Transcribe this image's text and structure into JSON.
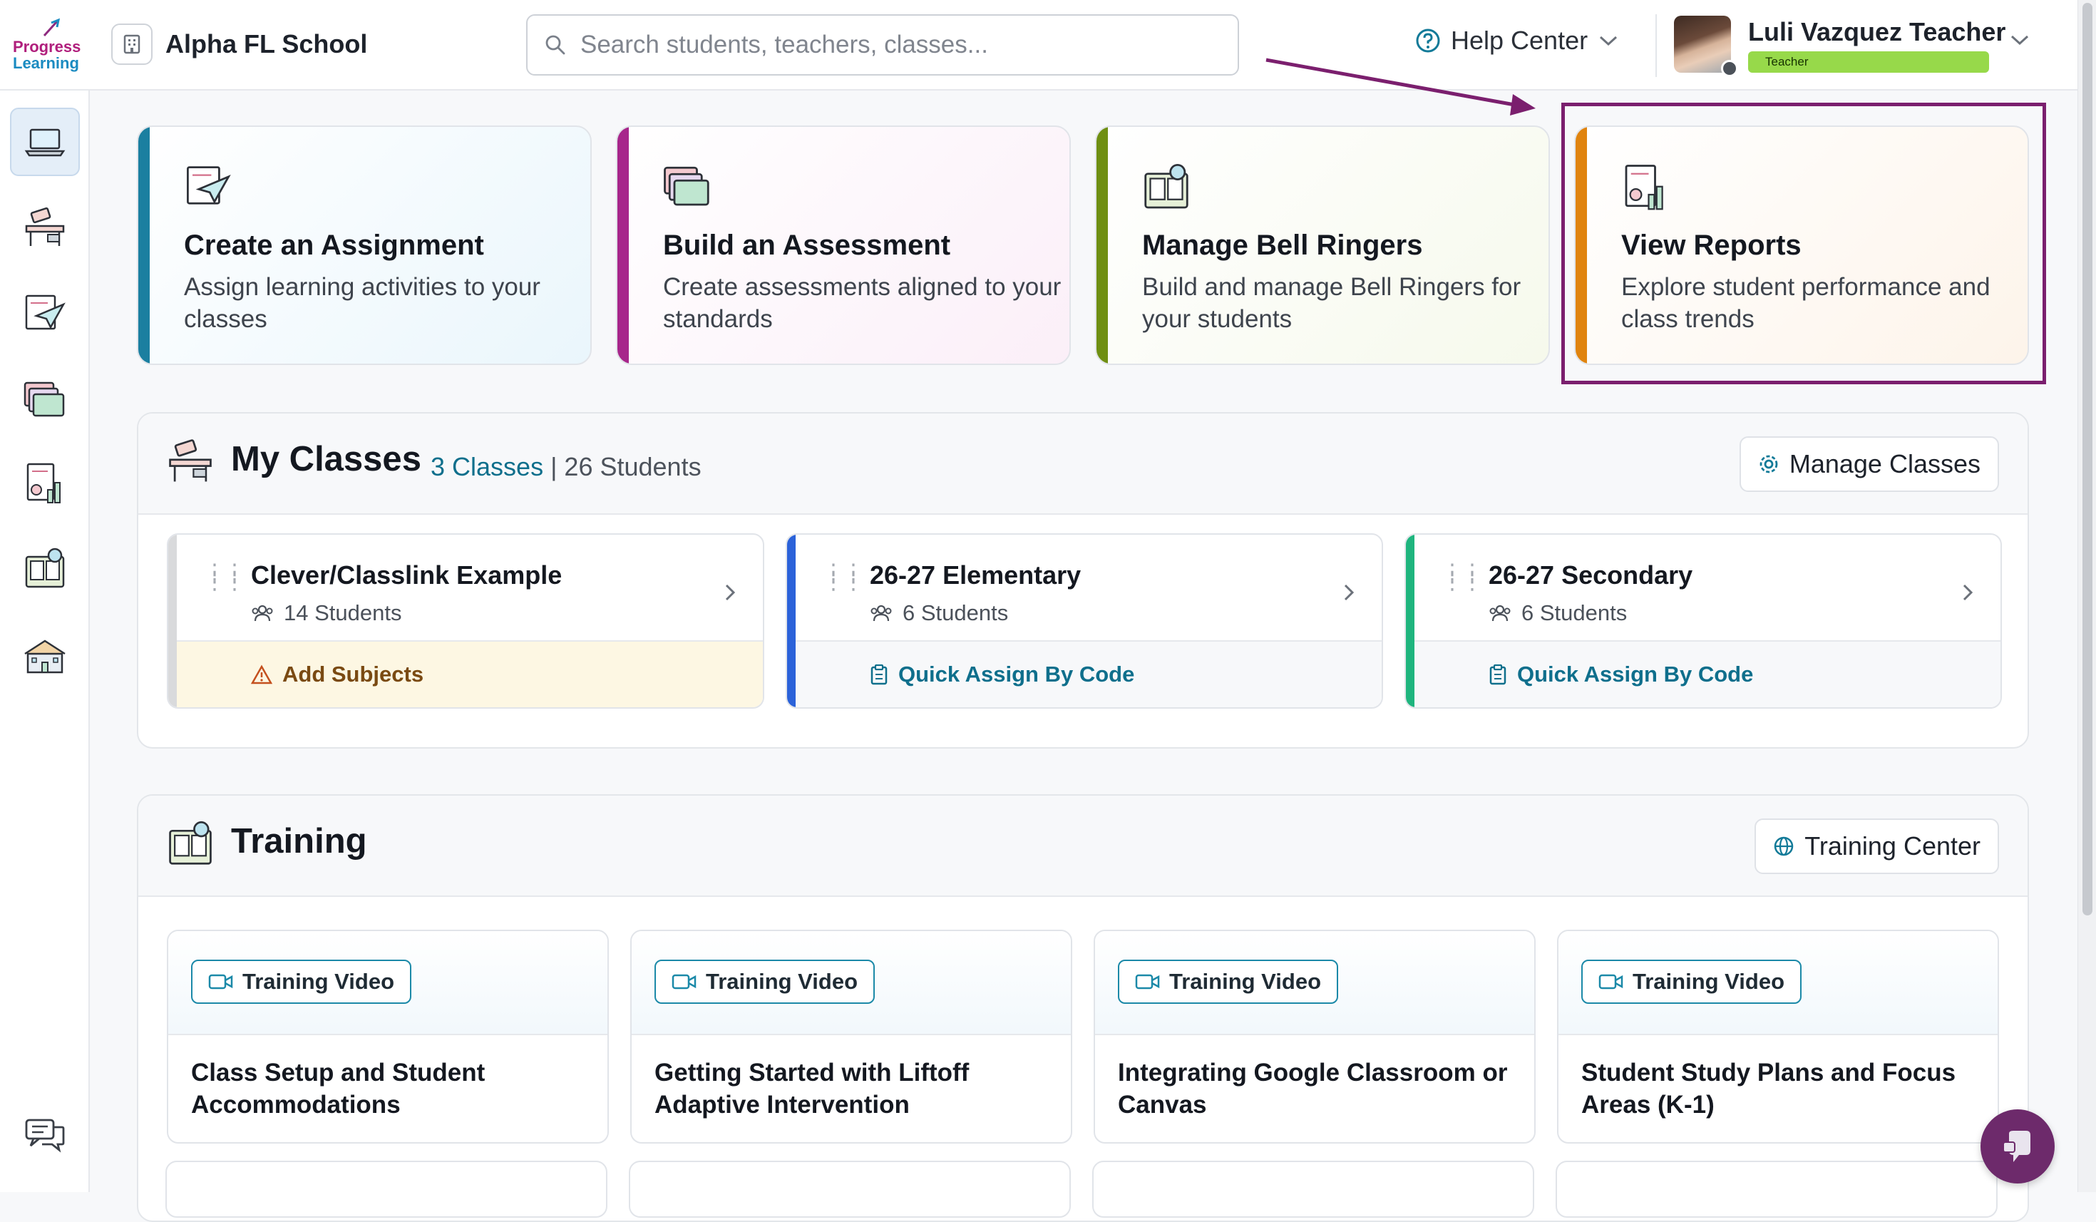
{
  "app": {
    "logo_line1": "Progress",
    "logo_line2": "Learning",
    "school_name": "Alpha FL School"
  },
  "search": {
    "placeholder": "Search students, teachers, classes..."
  },
  "header": {
    "help_label": "Help Center",
    "user_name": "Luli Vazquez Teacher",
    "user_role": "Teacher"
  },
  "sidebar": {
    "items": [
      {
        "name": "dashboard",
        "icon": "laptop-icon",
        "active": true
      },
      {
        "name": "classes",
        "icon": "desk-icon"
      },
      {
        "name": "assignments",
        "icon": "paper-plane-icon"
      },
      {
        "name": "assessments",
        "icon": "folders-icon"
      },
      {
        "name": "reports",
        "icon": "report-chart-icon"
      },
      {
        "name": "training",
        "icon": "training-book-icon"
      },
      {
        "name": "school",
        "icon": "school-building-icon"
      }
    ],
    "bottom_icon": "chat-bubbles-icon"
  },
  "quick_actions": [
    {
      "title": "Create an Assignment",
      "desc": "Assign learning activities to your classes",
      "accent": "#1b7fa0",
      "bg": "#eaf6fc"
    },
    {
      "title": "Build an Assessment",
      "desc": "Create assessments aligned to your standards",
      "accent": "#a7268b",
      "bg": "#fbeff8"
    },
    {
      "title": "Manage Bell Ringers",
      "desc": "Build and manage Bell Ringers for your students",
      "accent": "#6f8f12",
      "bg": "#f6f9ec"
    },
    {
      "title": "View Reports",
      "desc": "Explore student performance and class trends",
      "accent": "#e0840f",
      "bg": "#fdf4ea"
    }
  ],
  "classes": {
    "title": "My Classes",
    "count_link": "3 Classes",
    "students_text": "| 26 Students",
    "manage_label": "Manage Classes",
    "items": [
      {
        "name": "Clever/Classlink Example",
        "students": "14 Students",
        "footer": "Add Subjects",
        "footer_type": "warning",
        "bar": "#d9dadc"
      },
      {
        "name": "26-27 Elementary",
        "students": "6 Students",
        "footer": "Quick Assign By Code",
        "footer_type": "link",
        "bar": "#2b62d9"
      },
      {
        "name": "26-27 Secondary",
        "students": "6 Students",
        "footer": "Quick Assign By Code",
        "footer_type": "link",
        "bar": "#1fb57e"
      }
    ]
  },
  "training": {
    "title": "Training",
    "center_label": "Training Center",
    "badge_label": "Training Video",
    "items": [
      {
        "title": "Class Setup and Student Accommodations"
      },
      {
        "title": "Getting Started with Liftoff Adaptive Intervention"
      },
      {
        "title": "Integrating Google Classroom or Canvas"
      },
      {
        "title": "Student Study Plans and Focus Areas (K-1)"
      }
    ]
  }
}
